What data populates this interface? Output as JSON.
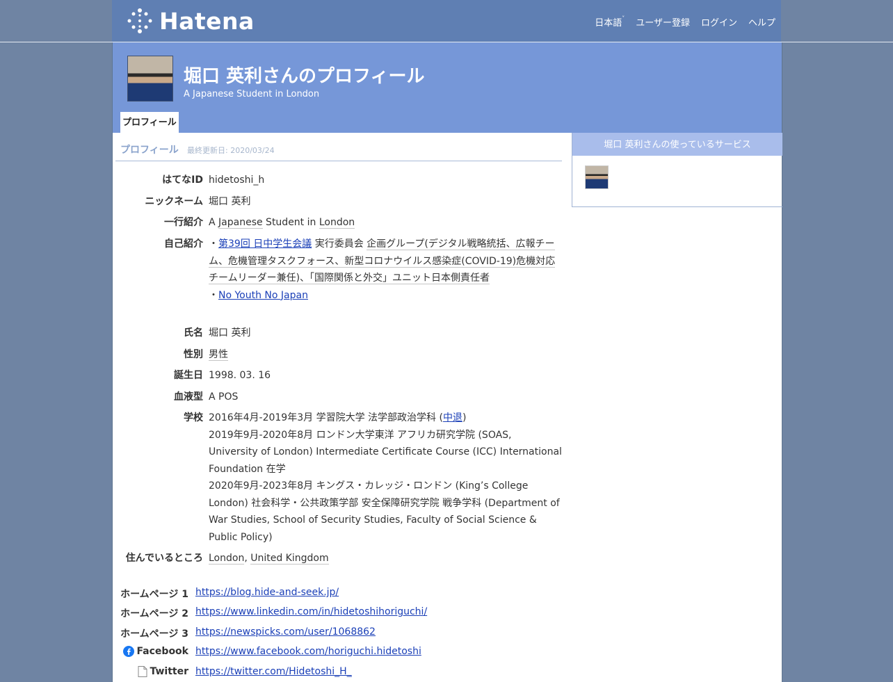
{
  "brand": {
    "logo_text": "Hatena"
  },
  "topnav": {
    "language": "日本語",
    "signup": "ユーザー登録",
    "login": "ログイン",
    "help": "ヘルプ"
  },
  "header": {
    "title": "堀口 英利さんのプロフィール",
    "subtitle": "A Japanese Student in London",
    "tab": "プロフィール"
  },
  "section": {
    "title": "プロフィール",
    "updated": "最終更新日: 2020/03/24"
  },
  "profile": {
    "id_label": "はてなID",
    "id_value": "hidetoshi_h",
    "nick_label": "ニックネーム",
    "nick_value": "堀口 英利",
    "intro_label": "一行紹介",
    "intro_a": "A ",
    "intro_japanese": "Japanese",
    "intro_mid": " Student in ",
    "intro_london": "London",
    "self_label": "自己紹介",
    "self_bullet1": "・",
    "self_link1": "第39回 日中学生会議",
    "self_text1a": " 実行委員会 ",
    "self_text1b": "企画グループ(デジタル戦略統括、広報チーム、危機管理タスクフォース、新型コロナウイルス感染症(COVID-19)危機対応チームリーダー兼任)、「国際関係と外交」ユニット日本側責任者",
    "self_bullet2": "・",
    "self_link2": "No Youth No Japan",
    "name_label": "氏名",
    "name_value": "堀口 英利",
    "gender_label": "性別",
    "gender_value": "男性",
    "birth_label": "誕生日",
    "birth_value": "1998. 03. 16",
    "blood_label": "血液型",
    "blood_value": "A POS",
    "school_label": "学校",
    "school_1a": "2016年4月-2019年3月 学習院大学 法学部政治学科 (",
    "school_1link": "中退",
    "school_1b": ")",
    "school_2": "2019年9月-2020年8月 ロンドン大学東洋 アフリカ研究学院 (SOAS, University of London) Intermediate Certificate Course (ICC) International Foundation 在学",
    "school_3": "2020年9月-2023年8月 キングス・カレッジ・ロンドン (King’s College London) 社会科学・公共政策学部 安全保障研究学院 戦争学科 (Department of War Studies, School of Security Studies, Faculty of Social Science & Public Policy)",
    "live_label": "住んでいるところ",
    "live_city": "London",
    "live_sep": ", ",
    "live_country": "United Kingdom"
  },
  "homepages": [
    {
      "label": "ホームページ 1",
      "url": "https://blog.hide-and-seek.jp/"
    },
    {
      "label": "ホームページ 2",
      "url": "https://www.linkedin.com/in/hidetoshihoriguchi/"
    },
    {
      "label": "ホームページ 3",
      "url": "https://newspicks.com/user/1068862"
    },
    {
      "label": "Facebook",
      "url": "https://www.facebook.com/horiguchi.hidetoshi"
    },
    {
      "label": "Twitter",
      "url": "https://twitter.com/Hidetoshi_H_"
    }
  ],
  "sidebar": {
    "title": "堀口 英利さんの使っているサービス"
  },
  "colors": {
    "header_blue": "#7697d8",
    "topbar_blue": "#5f7fb3",
    "link": "#1a3fb7",
    "sidebar_head": "#a9bdeb"
  },
  "icons": [
    "hatena-dots-logo-icon",
    "chevron-down-icon",
    "facebook-icon",
    "document-icon"
  ]
}
